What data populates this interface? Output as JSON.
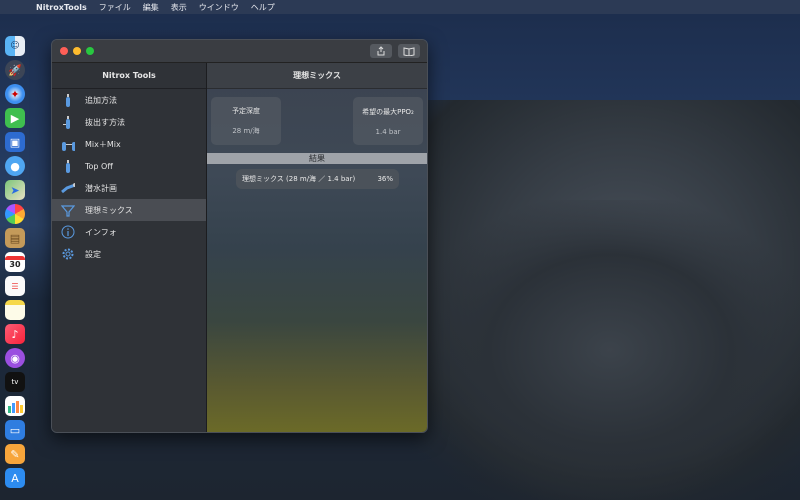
{
  "menubar": {
    "app_name": "NitroxTools",
    "items": [
      "ファイル",
      "編集",
      "表示",
      "ウインドウ",
      "ヘルプ"
    ]
  },
  "dock": {
    "icons": [
      "finder-icon",
      "launchpad-icon",
      "safari-icon",
      "facetime-icon",
      "photo-booth-icon",
      "messages-icon",
      "maps-icon",
      "photos-icon",
      "contacts-icon",
      "calendar-icon",
      "reminders-icon",
      "notes-icon",
      "music-icon",
      "podcasts-icon",
      "tv-icon",
      "numbers-icon",
      "keynote-icon",
      "pages-icon",
      "app-store-icon"
    ],
    "calendar_day": "30"
  },
  "window": {
    "sidebar_title": "Nitrox Tools",
    "sidebar_items": [
      {
        "label": "追加方法",
        "icon": "cylinder-icon"
      },
      {
        "label": "抜出す方法",
        "icon": "cylinder-small-icon"
      },
      {
        "label": "Mix＋Mix",
        "icon": "twin-cylinder-icon"
      },
      {
        "label": "Top Off",
        "icon": "cylinder-icon"
      },
      {
        "label": "潜水計画",
        "icon": "diver-icon"
      },
      {
        "label": "理想ミックス",
        "icon": "funnel-icon"
      },
      {
        "label": "インフォ",
        "icon": "info-icon"
      },
      {
        "label": "設定",
        "icon": "gear-icon"
      }
    ],
    "selected_index": 5,
    "main_title": "理想ミックス",
    "depth_card": {
      "label": "予定深度",
      "value": "28 m/海"
    },
    "ppo2_card": {
      "label": "希望の最大PPO₂",
      "value": "1.4 bar"
    },
    "section_title": "結果",
    "result": {
      "label": "理想ミックス (28 m/海 ／ 1.4 bar)",
      "value": "36%"
    }
  },
  "colors": {
    "close": "#ff5f57",
    "minimize": "#febc2e",
    "zoom": "#28c840",
    "accent_blue": "#5a9ae0"
  }
}
